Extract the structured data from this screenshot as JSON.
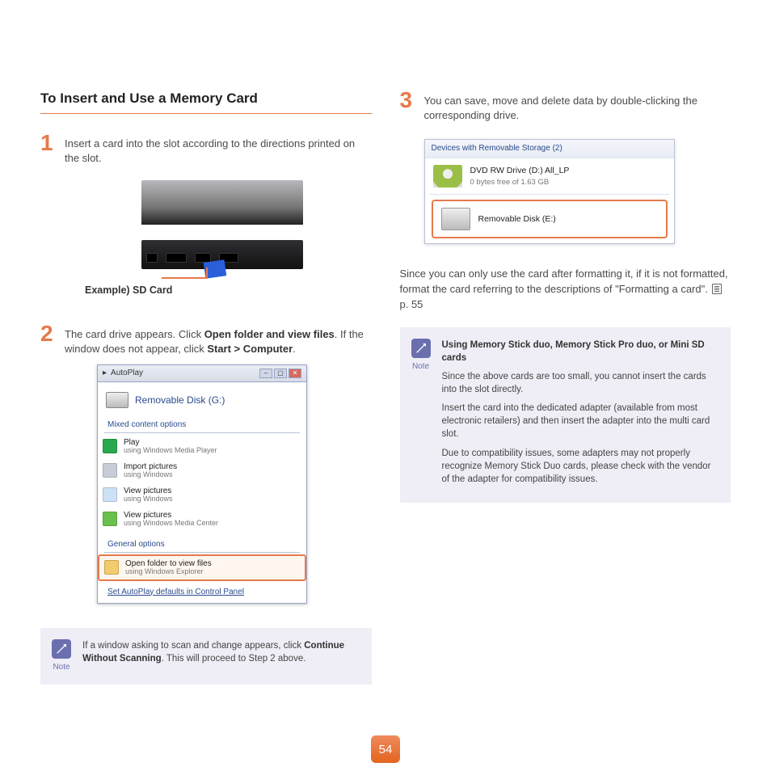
{
  "heading": "To Insert and Use a Memory Card",
  "step1": {
    "text": "Insert a card into the slot according to the directions printed on the slot.",
    "example_label": "Example) SD Card"
  },
  "step2": {
    "prefix": "The card drive appears. Click ",
    "bold1": "Open folder and view files",
    "mid": ". If the window does not appear, click ",
    "bold2": "Start > Computer",
    "suffix": "."
  },
  "step3": {
    "text": "You can save, move and delete data by double-clicking the corresponding drive."
  },
  "autoplay": {
    "title": "AutoPlay",
    "disk_label": "Removable Disk (G:)",
    "section_mixed": "Mixed content options",
    "items": [
      {
        "title": "Play",
        "sub": "using Windows Media Player",
        "color": "#2aa84d"
      },
      {
        "title": "Import pictures",
        "sub": "using Windows",
        "color": "#c7ccd6"
      },
      {
        "title": "View pictures",
        "sub": "using Windows",
        "color": "#cde1f5"
      },
      {
        "title": "View pictures",
        "sub": "using Windows Media Center",
        "color": "#6bbf4d"
      }
    ],
    "section_general": "General options",
    "open_title": "Open folder to view files",
    "open_sub": "using Windows Explorer",
    "link": "Set AutoPlay defaults in Control Panel"
  },
  "devices": {
    "header": "Devices with Removable Storage (2)",
    "dvd_title": "DVD RW Drive (D:) All_LP",
    "dvd_sub": "0 bytes free of 1.63 GB",
    "removable": "Removable Disk (E:)"
  },
  "format_para": {
    "pre": "Since you can only use the card after formatting it, if it is not formatted, format the card referring to the descriptions of \"Formatting a card\". ",
    "ref": " p. 55"
  },
  "note_left": {
    "label": "Note",
    "body_pre": "If a window asking to scan and change appears, click ",
    "body_bold": "Continue Without Scanning",
    "body_post": ". This will proceed to Step 2 above."
  },
  "note_right": {
    "label": "Note",
    "title": "Using Memory Stick duo, Memory Stick Pro duo, or Mini SD cards",
    "p1": "Since the above cards are too small, you cannot insert the cards into the slot directly.",
    "p2": "Insert the card into the dedicated adapter (available from most electronic retailers) and then insert the adapter into the multi card slot.",
    "p3": "Due to compatibility issues, some adapters may not properly recognize Memory Stick Duo cards, please check with the vendor of the adapter for compatibility issues."
  },
  "page_number": "54"
}
